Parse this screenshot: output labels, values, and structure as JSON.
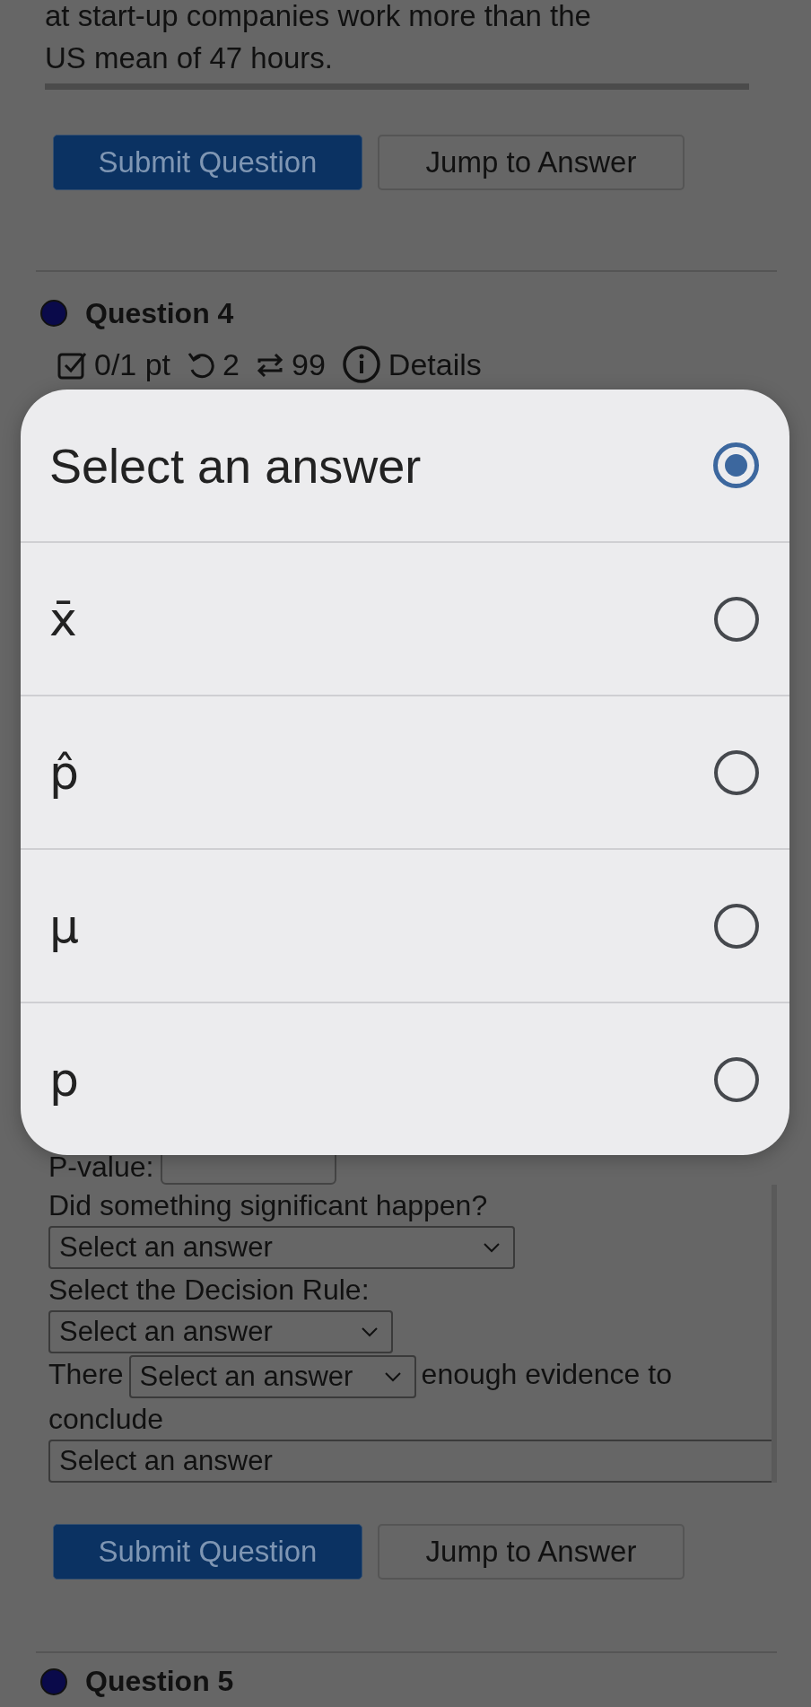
{
  "previous_question": {
    "text_lines": [
      "at start-up companies work more than the",
      "US mean of 47 hours."
    ],
    "buttons": [
      {
        "label": "Submit Question",
        "kind": "primary"
      },
      {
        "label": "Jump to Answer",
        "kind": "secondary"
      }
    ]
  },
  "question": {
    "title": "Question 4",
    "score": "0/1 pt",
    "retries": "2",
    "attempts": "99",
    "details": "Details",
    "pvalue_label": "P-value:",
    "fields": [
      {
        "kind": "label",
        "text": "Did something significant happen?"
      },
      {
        "kind": "select",
        "value": "Select an answer"
      },
      {
        "kind": "label",
        "text": "Select the Decision Rule:"
      },
      {
        "kind": "select",
        "value": "Select an answer"
      },
      {
        "kind": "sentence",
        "before": "There",
        "value": "Select an answer",
        "after": "enough evidence to"
      },
      {
        "kind": "label",
        "text": "conclude"
      },
      {
        "kind": "select",
        "value": "Select an answer"
      }
    ],
    "buttons": [
      {
        "label": "Submit Question",
        "kind": "primary"
      },
      {
        "label": "Jump to Answer",
        "kind": "secondary"
      }
    ]
  },
  "next_question": {
    "title": "Question 5"
  },
  "picker": {
    "options": [
      {
        "label": "Select an answer",
        "selected": true
      },
      {
        "label": "x̄",
        "selected": false
      },
      {
        "label": "p̂",
        "selected": false
      },
      {
        "label": "μ",
        "selected": false
      },
      {
        "label": "p",
        "selected": false
      }
    ]
  }
}
